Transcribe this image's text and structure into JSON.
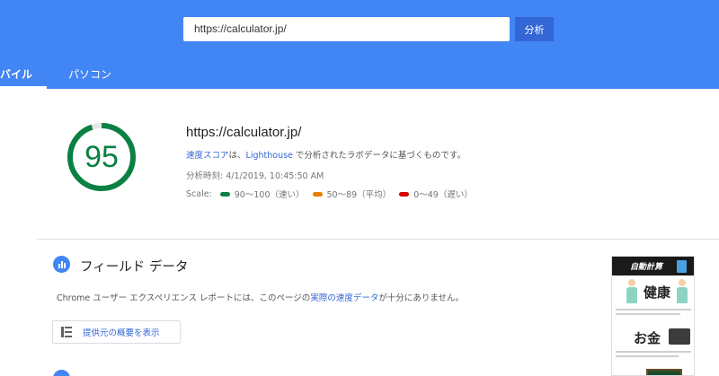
{
  "header": {
    "url_value": "https://calculator.jp/",
    "analyze_label": "分析",
    "tabs": [
      {
        "label": "バイル",
        "active": true
      },
      {
        "label": "パソコン",
        "active": false
      }
    ],
    "color": "#4285f4"
  },
  "summary": {
    "score": "95",
    "score_fraction": 0.95,
    "score_color": "#0b8043",
    "url": "https://calculator.jp/",
    "desc_prefix": "速度スコア",
    "desc_middle": "は、",
    "desc_link": "Lighthouse",
    "desc_suffix": " で分析されたラボデータに基づくものです。",
    "timestamp": "分析時刻: 4/1/2019, 10:45:50 AM",
    "scale_label": "Scale:",
    "scale": [
      {
        "label": "90～100（速い）",
        "color": "#0b8043"
      },
      {
        "label": "50～89（平均）",
        "color": "#e67c00"
      },
      {
        "label": "0～49（遅い）",
        "color": "#d50000"
      }
    ]
  },
  "field_data": {
    "title": "フィールド データ",
    "text_prefix": "Chrome ユーザー エクスペリエンス レポートには、このページの",
    "text_link": "実際の速度データ",
    "text_suffix": "が十分にありません。",
    "origin_button": "提供元の概要を表示"
  },
  "thumbnail": {
    "logo": "自動計算",
    "health": "健康",
    "money": "お金"
  }
}
